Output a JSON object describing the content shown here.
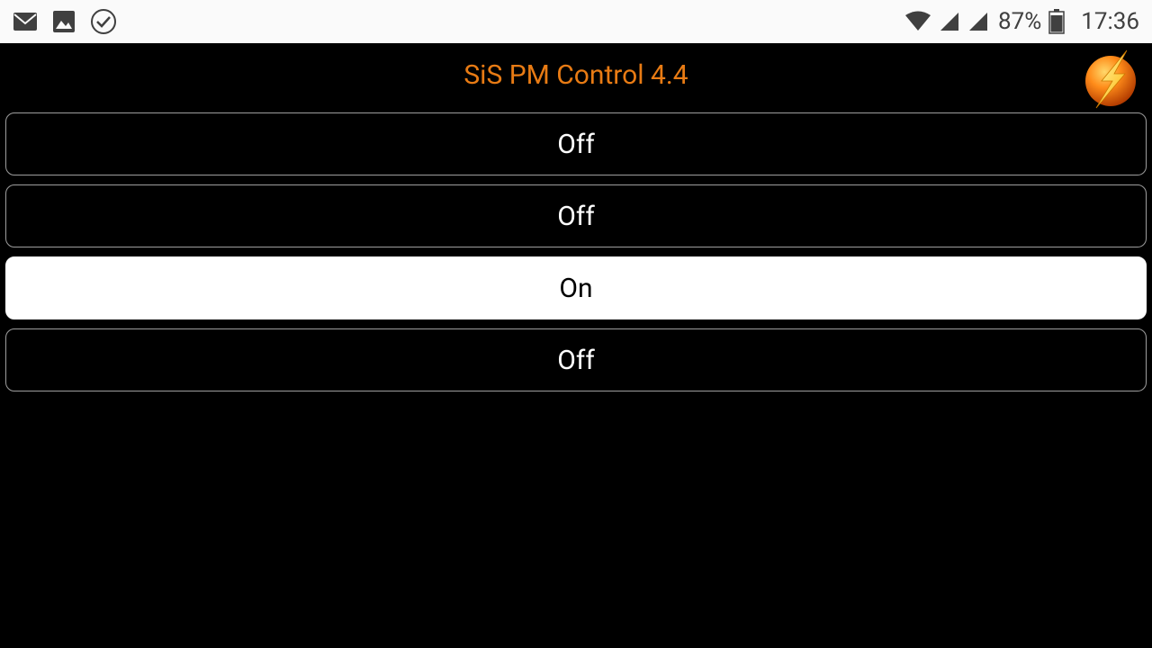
{
  "status_bar": {
    "battery_percent": "87%",
    "clock": "17:36"
  },
  "app": {
    "title": "SiS PM Control 4.4"
  },
  "outlets": [
    {
      "label": "Off",
      "state": "off"
    },
    {
      "label": "Off",
      "state": "off"
    },
    {
      "label": "On",
      "state": "on"
    },
    {
      "label": "Off",
      "state": "off"
    }
  ]
}
